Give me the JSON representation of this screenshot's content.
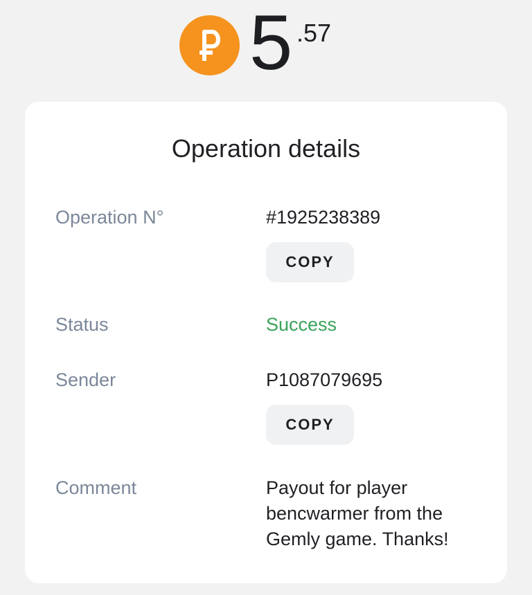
{
  "balance": {
    "currency_icon": "p-coin-icon",
    "currency_color": "#f5931e",
    "integer": "5",
    "decimal": ".57"
  },
  "details": {
    "title": "Operation details",
    "operation_label": "Operation N°",
    "operation_value": "#1925238389",
    "status_label": "Status",
    "status_value": "Success",
    "status_color": "#3aa35a",
    "sender_label": "Sender",
    "sender_value": "P1087079695",
    "comment_label": "Comment",
    "comment_value": "Payout for player bencwarmer from the Gemly game. Thanks!",
    "copy_label": "COPY"
  }
}
